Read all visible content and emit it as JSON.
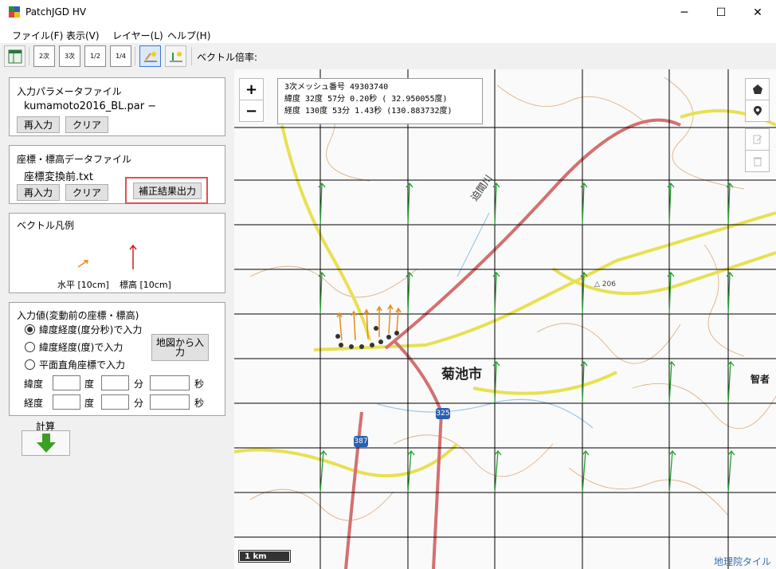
{
  "window": {
    "title": "PatchJGD HV",
    "minimize": "─",
    "maximize": "☐",
    "close": "✕"
  },
  "menu": [
    "ファイル(F)",
    "表示(V)",
    "レイヤー(L)",
    "ヘルプ(H)"
  ],
  "toolbar": {
    "buttons": [
      "2次",
      "3次",
      "1/2",
      "1/4"
    ],
    "vector_label": "ベクトル倍率:"
  },
  "param_panel": {
    "title": "入力パラメータファイル",
    "filename": "kumamoto2016_BL.par −",
    "reinput": "再入力",
    "clear": "クリア"
  },
  "coord_panel": {
    "title": "座標・標高データファイル",
    "filename": "座標変換前.txt",
    "reinput": "再入力",
    "clear": "クリア",
    "output": "補正結果出力"
  },
  "legend_panel": {
    "title": "ベクトル凡例",
    "horizontal": "水平 [10cm]",
    "height": "標高 [10cm]"
  },
  "input_panel": {
    "title": "入力値(変動前の座標・標高)",
    "options": [
      "緯度経度(度分秒)で入力",
      "緯度経度(度)で入力",
      "平面直角座標で入力"
    ],
    "selected_index": 0,
    "map_input": "地図から入力",
    "lat_label": "緯度",
    "lon_label": "経度",
    "deg": "度",
    "min": "分",
    "sec": "秒"
  },
  "calc": {
    "label": "計算"
  },
  "map": {
    "info_lines": [
      "3次メッシュ番号  49303740",
      "緯度  32度 57分  0.20秒 ( 32.950055度)",
      "経度 130度 53分  1.43秒 (130.883732度)"
    ],
    "zoom_in": "+",
    "zoom_out": "−",
    "city_label": "菊池市",
    "river_label": "迫間川",
    "peak_label": "△ 206",
    "city2_label": "智者",
    "route_325": "325",
    "route_387": "387",
    "scale": "1 km",
    "attribution": "地理院タイル"
  },
  "colors": {
    "highlight": "#e05050",
    "vector_green": "#1e9e2a",
    "vector_orange": "#e88a20",
    "vector_red": "#cc2020",
    "road_yellow": "#f0e040",
    "road_red": "#d06a6a",
    "calc_green": "#3aa022"
  }
}
